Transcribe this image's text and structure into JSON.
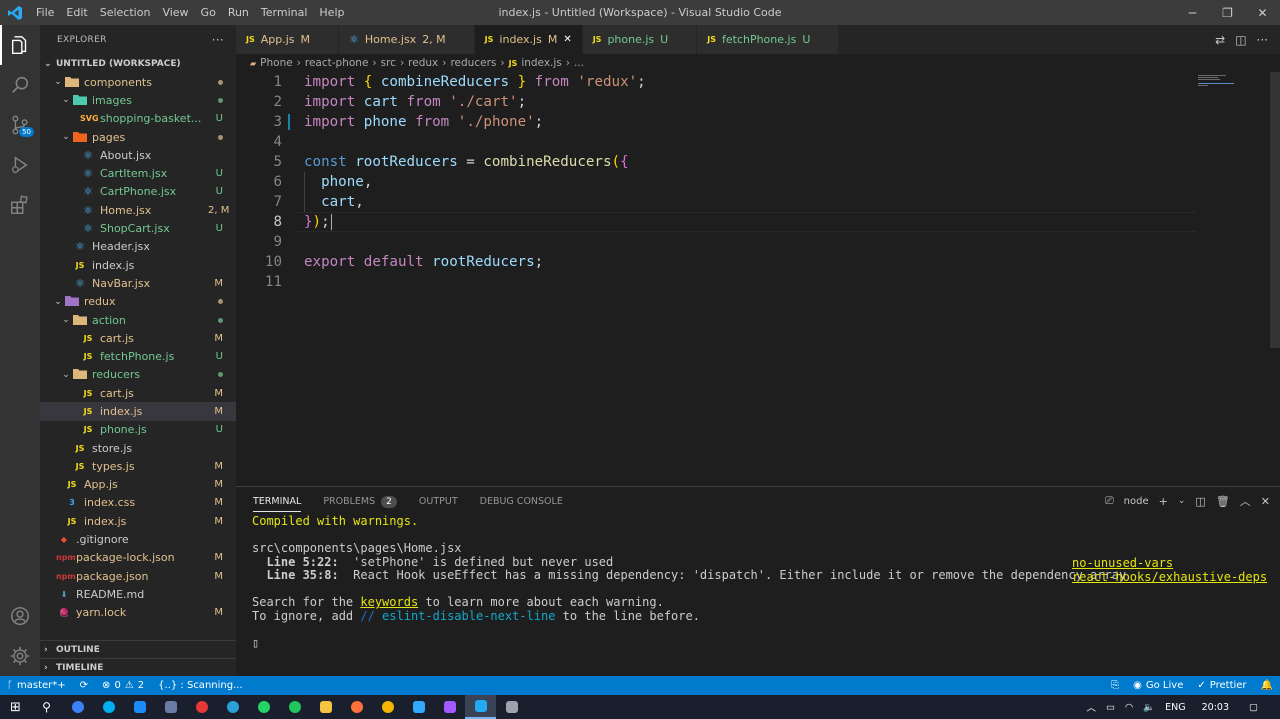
{
  "titlebar": {
    "menu": [
      "File",
      "Edit",
      "Selection",
      "View",
      "Go",
      "Run",
      "Terminal",
      "Help"
    ],
    "title": "index.js - Untitled (Workspace) - Visual Studio Code"
  },
  "activity": {
    "items": [
      "files-icon",
      "search-icon",
      "source-control-icon",
      "run-debug-icon",
      "extensions-icon"
    ],
    "scm_badge": "50",
    "bottom": [
      "account-icon",
      "settings-gear-icon"
    ]
  },
  "sidebar": {
    "header": "EXPLORER",
    "more": "···",
    "workspace": "UNTITLED (WORKSPACE)",
    "tree": [
      {
        "name": "components",
        "kind": "folder",
        "depth": 2,
        "open": true,
        "status": "dot",
        "color": "#e2c08d",
        "icon_color": "#dcb67a"
      },
      {
        "name": "images",
        "kind": "folder",
        "depth": 3,
        "open": true,
        "status": "dot",
        "color": "#73c991",
        "icon_color": "#4ec9b0"
      },
      {
        "name": "shopping-basket...",
        "kind": "file",
        "depth": 4,
        "icon": "SVG",
        "status": "U",
        "color": "#73c991",
        "icon_color": "#ffb13b"
      },
      {
        "name": "pages",
        "kind": "folder",
        "depth": 3,
        "open": true,
        "status": "dot",
        "color": "#e2c08d",
        "icon_color": "#f0631e"
      },
      {
        "name": "About.jsx",
        "kind": "file",
        "depth": 4,
        "icon": "⚛",
        "status": "",
        "color": "#cccccc",
        "icon_color": "#4fc1ff"
      },
      {
        "name": "CartItem.jsx",
        "kind": "file",
        "depth": 4,
        "icon": "⚛",
        "status": "U",
        "color": "#73c991",
        "icon_color": "#4fc1ff"
      },
      {
        "name": "CartPhone.jsx",
        "kind": "file",
        "depth": 4,
        "icon": "⚛",
        "status": "U",
        "color": "#73c991",
        "icon_color": "#4fc1ff"
      },
      {
        "name": "Home.jsx",
        "kind": "file",
        "depth": 4,
        "icon": "⚛",
        "status": "2, M",
        "color": "#e2c08d",
        "icon_color": "#4fc1ff"
      },
      {
        "name": "ShopCart.jsx",
        "kind": "file",
        "depth": 4,
        "icon": "⚛",
        "status": "U",
        "color": "#73c991",
        "icon_color": "#4fc1ff"
      },
      {
        "name": "Header.jsx",
        "kind": "file",
        "depth": 3,
        "icon": "⚛",
        "status": "",
        "color": "#cccccc",
        "icon_color": "#4fc1ff"
      },
      {
        "name": "index.js",
        "kind": "file",
        "depth": 3,
        "icon": "JS",
        "status": "",
        "color": "#cccccc",
        "icon_color": "#f5de19"
      },
      {
        "name": "NavBar.jsx",
        "kind": "file",
        "depth": 3,
        "icon": "⚛",
        "status": "M",
        "color": "#e2c08d",
        "icon_color": "#4fc1ff"
      },
      {
        "name": "redux",
        "kind": "folder",
        "depth": 2,
        "open": true,
        "status": "dot",
        "color": "#e2c08d",
        "icon_color": "#a074c4"
      },
      {
        "name": "action",
        "kind": "folder",
        "depth": 3,
        "open": true,
        "status": "dot",
        "color": "#73c991",
        "icon_color": "#dcb67a"
      },
      {
        "name": "cart.js",
        "kind": "file",
        "depth": 4,
        "icon": "JS",
        "status": "M",
        "color": "#e2c08d",
        "icon_color": "#f5de19"
      },
      {
        "name": "fetchPhone.js",
        "kind": "file",
        "depth": 4,
        "icon": "JS",
        "status": "U",
        "color": "#73c991",
        "icon_color": "#f5de19"
      },
      {
        "name": "reducers",
        "kind": "folder",
        "depth": 3,
        "open": true,
        "status": "dot",
        "color": "#73c991",
        "icon_color": "#dcb67a"
      },
      {
        "name": "cart.js",
        "kind": "file",
        "depth": 4,
        "icon": "JS",
        "status": "M",
        "color": "#e2c08d",
        "icon_color": "#f5de19"
      },
      {
        "name": "index.js",
        "kind": "file",
        "depth": 4,
        "icon": "JS",
        "status": "M",
        "color": "#e2c08d",
        "icon_color": "#f5de19",
        "selected": true
      },
      {
        "name": "phone.js",
        "kind": "file",
        "depth": 4,
        "icon": "JS",
        "status": "U",
        "color": "#73c991",
        "icon_color": "#f5de19"
      },
      {
        "name": "store.js",
        "kind": "file",
        "depth": 3,
        "icon": "JS",
        "status": "",
        "color": "#cccccc",
        "icon_color": "#f5de19"
      },
      {
        "name": "types.js",
        "kind": "file",
        "depth": 3,
        "icon": "JS",
        "status": "M",
        "color": "#e2c08d",
        "icon_color": "#f5de19"
      },
      {
        "name": "App.js",
        "kind": "file",
        "depth": 2,
        "icon": "JS",
        "status": "M",
        "color": "#e2c08d",
        "icon_color": "#f5de19"
      },
      {
        "name": "index.css",
        "kind": "file",
        "depth": 2,
        "icon": "3",
        "status": "M",
        "color": "#e2c08d",
        "icon_color": "#42a5f5"
      },
      {
        "name": "index.js",
        "kind": "file",
        "depth": 2,
        "icon": "JS",
        "status": "M",
        "color": "#e2c08d",
        "icon_color": "#f5de19"
      },
      {
        "name": ".gitignore",
        "kind": "file",
        "depth": 1,
        "icon": "◆",
        "status": "",
        "color": "#cccccc",
        "icon_color": "#f14e32"
      },
      {
        "name": "package-lock.json",
        "kind": "file",
        "depth": 1,
        "icon": "npm",
        "status": "M",
        "color": "#e2c08d",
        "icon_color": "#cb3837"
      },
      {
        "name": "package.json",
        "kind": "file",
        "depth": 1,
        "icon": "npm",
        "status": "M",
        "color": "#e2c08d",
        "icon_color": "#cb3837"
      },
      {
        "name": "README.md",
        "kind": "file",
        "depth": 1,
        "icon": "⬇",
        "status": "",
        "color": "#cccccc",
        "icon_color": "#519aba"
      },
      {
        "name": "yarn.lock",
        "kind": "file",
        "depth": 1,
        "icon": "🧶",
        "status": "M",
        "color": "#e2c08d",
        "icon_color": "#2c8ebb"
      }
    ],
    "outline": "OUTLINE",
    "timeline": "TIMELINE"
  },
  "tabs": [
    {
      "icon": "JS",
      "name": "App.js",
      "status": "M",
      "color": "#e2c08d",
      "icon_color": "#f5de19",
      "active": false
    },
    {
      "icon": "⚛",
      "name": "Home.jsx",
      "status": "2, M",
      "color": "#e2c08d",
      "icon_color": "#4fc1ff",
      "active": false
    },
    {
      "icon": "JS",
      "name": "index.js",
      "status": "M",
      "color": "#e2c08d",
      "icon_color": "#f5de19",
      "active": true
    },
    {
      "icon": "JS",
      "name": "phone.js",
      "status": "U",
      "color": "#73c991",
      "icon_color": "#f5de19",
      "active": false
    },
    {
      "icon": "JS",
      "name": "fetchPhone.js",
      "status": "U",
      "color": "#73c991",
      "icon_color": "#f5de19",
      "active": false
    }
  ],
  "breadcrumb": [
    "Phone",
    "react-phone",
    "src",
    "redux",
    "reducers",
    "index.js",
    "..."
  ],
  "editor": {
    "current_line": 8,
    "lines": [
      [
        [
          "kw2",
          "import"
        ],
        [
          "plain",
          " "
        ],
        [
          "br1",
          "{"
        ],
        [
          "plain",
          " "
        ],
        [
          "var",
          "combineReducers"
        ],
        [
          "plain",
          " "
        ],
        [
          "br1",
          "}"
        ],
        [
          "plain",
          " "
        ],
        [
          "kw2",
          "from"
        ],
        [
          "plain",
          " "
        ],
        [
          "str",
          "'redux'"
        ],
        [
          "plain",
          ";"
        ]
      ],
      [
        [
          "kw2",
          "import"
        ],
        [
          "plain",
          " "
        ],
        [
          "var",
          "cart"
        ],
        [
          "plain",
          " "
        ],
        [
          "kw2",
          "from"
        ],
        [
          "plain",
          " "
        ],
        [
          "str",
          "'./cart'"
        ],
        [
          "plain",
          ";"
        ]
      ],
      [
        [
          "kw2",
          "import"
        ],
        [
          "plain",
          " "
        ],
        [
          "var",
          "phone"
        ],
        [
          "plain",
          " "
        ],
        [
          "kw2",
          "from"
        ],
        [
          "plain",
          " "
        ],
        [
          "str",
          "'./phone'"
        ],
        [
          "plain",
          ";"
        ]
      ],
      [],
      [
        [
          "kw",
          "const"
        ],
        [
          "plain",
          " "
        ],
        [
          "var",
          "rootReducers"
        ],
        [
          "plain",
          " = "
        ],
        [
          "fn",
          "combineReducers"
        ],
        [
          "br1",
          "("
        ],
        [
          "br2",
          "{"
        ]
      ],
      [
        [
          "plain",
          "  "
        ],
        [
          "var",
          "phone"
        ],
        [
          "plain",
          ","
        ]
      ],
      [
        [
          "plain",
          "  "
        ],
        [
          "var",
          "cart"
        ],
        [
          "plain",
          ","
        ]
      ],
      [
        [
          "br2",
          "}"
        ],
        [
          "br1",
          ")"
        ],
        [
          "plain",
          ";"
        ]
      ],
      [],
      [
        [
          "kw2",
          "export"
        ],
        [
          "plain",
          " "
        ],
        [
          "kw2",
          "default"
        ],
        [
          "plain",
          " "
        ],
        [
          "var",
          "rootReducers"
        ],
        [
          "plain",
          ";"
        ]
      ],
      []
    ]
  },
  "panel": {
    "tabs": [
      "TERMINAL",
      "PROBLEMS",
      "OUTPUT",
      "DEBUG CONSOLE"
    ],
    "problems_count": "2",
    "shell": "node",
    "terminal": {
      "compiled": "Compiled with warnings.",
      "file": "src\\components\\pages\\Home.jsx",
      "w1_loc": "  Line 5:22:",
      "w1_msg": "  'setPhone' is defined but never used",
      "w1_rule": "no-unused-vars",
      "w2_loc": "  Line 35:8:",
      "w2_msg": "  React Hook useEffect has a missing dependency: 'dispatch'. Either include it or remove the dependency array",
      "w2_rule": "react-hooks/exhaustive-deps",
      "search_a": "Search for the ",
      "search_kw": "keywords",
      "search_b": " to learn more about each warning.",
      "ignore_a": "To ignore, add ",
      "ignore_cm": "// eslint-disable-next-line",
      "ignore_b": " to the line before."
    }
  },
  "statusbar": {
    "branch": "master*+",
    "sync_icon": "sync-icon",
    "errors": "0",
    "warnings": "2",
    "scanning": "{..} : Scanning...",
    "golive": "Go Live",
    "prettier": "Prettier"
  },
  "taskbar": {
    "apps": [
      {
        "name": "windows-start-icon",
        "color": "#ffffff"
      },
      {
        "name": "search-icon",
        "color": "#ffffff"
      },
      {
        "name": "edge-icon",
        "color": "#3b82f6"
      },
      {
        "name": "skype-icon",
        "color": "#00aff0"
      },
      {
        "name": "media-player-icon",
        "color": "#1d8cf8"
      },
      {
        "name": "chat-icon",
        "color": "#6b7ba8"
      },
      {
        "name": "record-icon",
        "color": "#e53935"
      },
      {
        "name": "telegram-icon",
        "color": "#2aa1da"
      },
      {
        "name": "whatsapp-icon",
        "color": "#25d366"
      },
      {
        "name": "kaspersky-icon",
        "color": "#22c55e"
      },
      {
        "name": "file-explorer-icon",
        "color": "#f5c542"
      },
      {
        "name": "firefox-icon",
        "color": "#ff7139"
      },
      {
        "name": "chrome-icon",
        "color": "#f4b400"
      },
      {
        "name": "photoshop-icon",
        "color": "#31a8ff"
      },
      {
        "name": "figma-icon",
        "color": "#a259ff"
      },
      {
        "name": "vscode-icon",
        "color": "#23a9f2"
      },
      {
        "name": "paint-icon",
        "color": "#9ca3af"
      }
    ],
    "lang": "ENG",
    "time": "20:03"
  }
}
